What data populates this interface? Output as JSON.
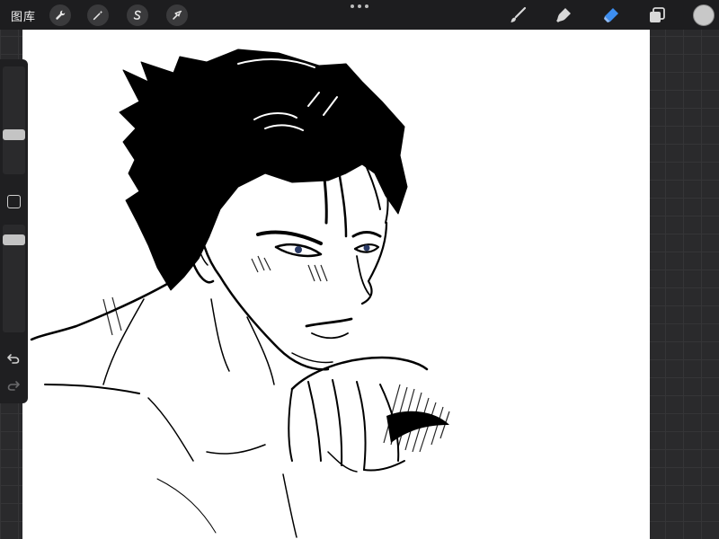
{
  "topbar": {
    "gallery_label": "图库",
    "left_tools": [
      {
        "name": "actions",
        "icon": "wrench-icon"
      },
      {
        "name": "adjustments",
        "icon": "magic-wand-icon"
      },
      {
        "name": "selection",
        "icon": "selection-s-icon"
      },
      {
        "name": "transform",
        "icon": "arrow-cursor-icon"
      }
    ],
    "right_tools": [
      {
        "name": "brush",
        "icon": "brush-icon",
        "active": false
      },
      {
        "name": "smudge",
        "icon": "smudge-icon",
        "active": false
      },
      {
        "name": "eraser",
        "icon": "eraser-icon",
        "active": true
      },
      {
        "name": "layers",
        "icon": "layers-icon",
        "active": false
      }
    ],
    "current_color": "#c8c8c8"
  },
  "sidebar": {
    "brush_size_level": 0.35,
    "opacity_level": 0.9,
    "icons": [
      "modify-square-icon",
      "undo-icon",
      "redo-icon"
    ]
  },
  "colors": {
    "topbar_bg": "#1d1d1f",
    "accent_active": "#3d8ef0",
    "canvas_bg": "#ffffff",
    "workspace_bg": "#2a2a2c"
  }
}
